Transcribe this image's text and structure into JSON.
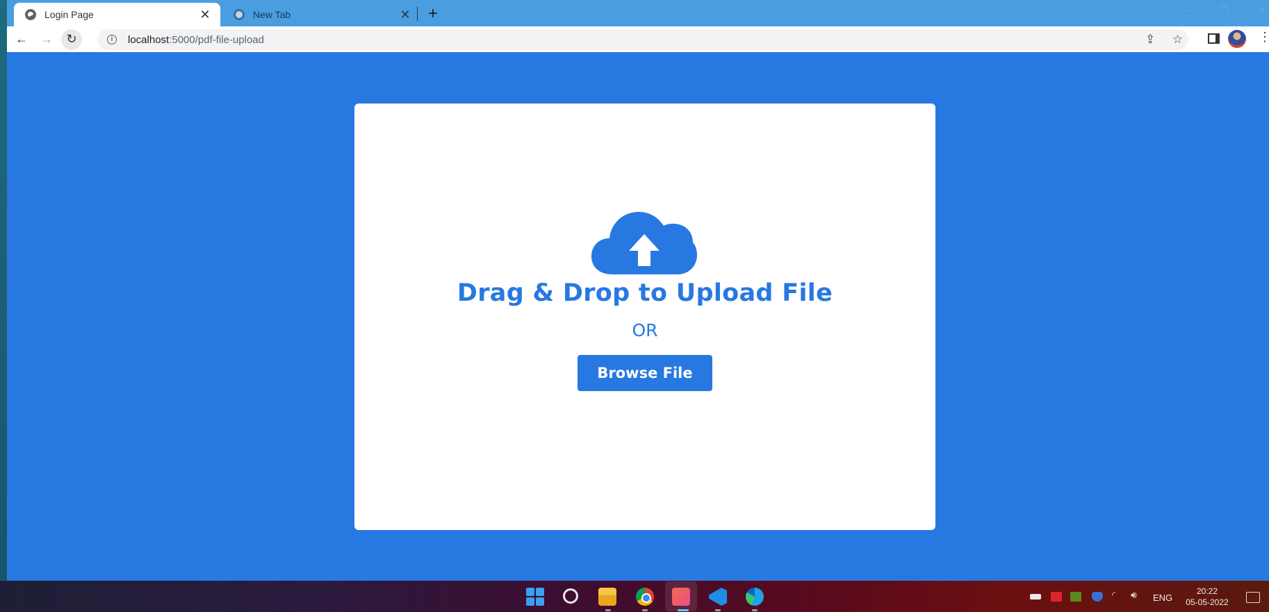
{
  "browser": {
    "tabs": [
      {
        "title": "Login Page",
        "active": true,
        "close_glyph": "✕"
      },
      {
        "title": "New Tab",
        "active": false,
        "close_glyph": "✕"
      }
    ],
    "new_tab_glyph": "+",
    "window_controls": {
      "chevron": "⌵",
      "minimize": "—",
      "restore": "❐",
      "close": "✕"
    },
    "nav": {
      "back_glyph": "←",
      "forward_glyph": "→",
      "reload_glyph": "↻"
    },
    "address": {
      "host": "localhost",
      "path": ":5000/pdf-file-upload",
      "info_glyph": "i"
    },
    "actions": {
      "share_glyph": "⇪",
      "star_glyph": "☆",
      "menu_glyph": "⋮"
    }
  },
  "page": {
    "heading": "Drag & Drop to Upload File",
    "or_text": "OR",
    "browse_button_label": "Browse File",
    "accent_color": "#2878e2",
    "background_color": "#2878e2"
  },
  "taskbar": {
    "pinned": [
      "start",
      "search",
      "file-explorer",
      "chrome",
      "snipping-tool",
      "vscode",
      "edge"
    ],
    "active_app": "snipping-tool",
    "tray": {
      "wifi_glyph": "◜",
      "volume_glyph": "🔊︎",
      "language": "ENG",
      "time": "20:22",
      "date": "05-05-2022"
    }
  }
}
